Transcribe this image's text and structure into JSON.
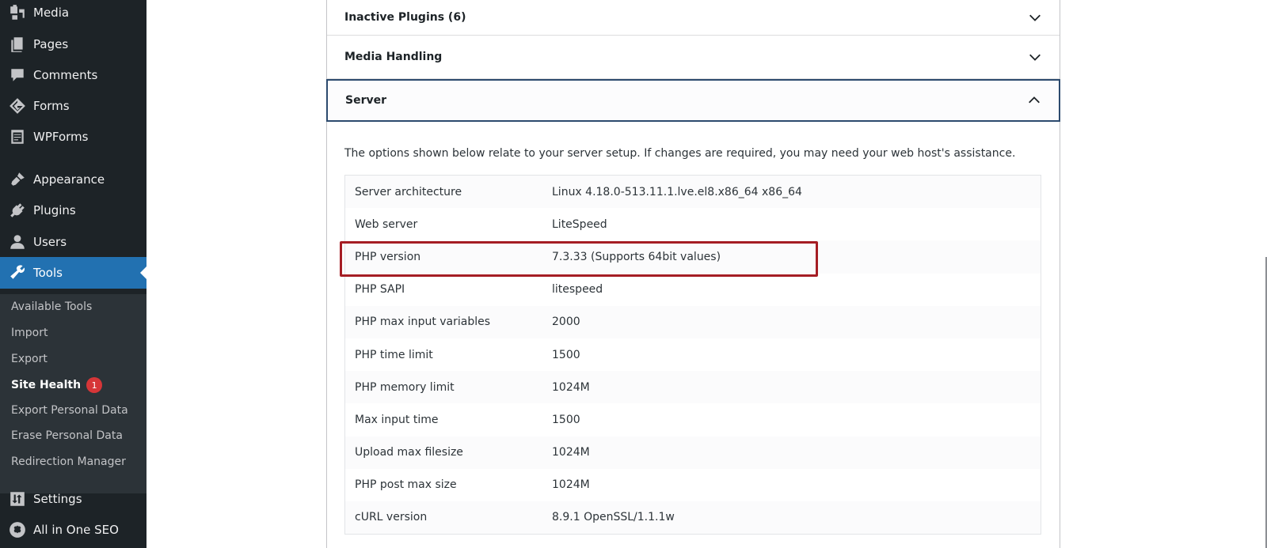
{
  "sidebar": {
    "menu": [
      {
        "label": "Media",
        "icon": "media-icon"
      },
      {
        "label": "Pages",
        "icon": "pages-icon"
      },
      {
        "label": "Comments",
        "icon": "comments-icon"
      },
      {
        "label": "Forms",
        "icon": "forms-icon"
      },
      {
        "label": "WPForms",
        "icon": "wpforms-icon"
      },
      {
        "label": "Appearance",
        "icon": "appearance-icon"
      },
      {
        "label": "Plugins",
        "icon": "plugins-icon"
      },
      {
        "label": "Users",
        "icon": "users-icon"
      },
      {
        "label": "Tools",
        "icon": "tools-icon",
        "active": true
      },
      {
        "label": "Settings",
        "icon": "settings-icon"
      },
      {
        "label": "All in One SEO",
        "icon": "aioseo-icon"
      }
    ],
    "submenu": [
      {
        "label": "Available Tools"
      },
      {
        "label": "Import"
      },
      {
        "label": "Export"
      },
      {
        "label": "Site Health",
        "current": true,
        "badge": "1"
      },
      {
        "label": "Export Personal Data"
      },
      {
        "label": "Erase Personal Data"
      },
      {
        "label": "Redirection Manager"
      }
    ]
  },
  "main": {
    "sections": [
      {
        "title": "Inactive Plugins (6)",
        "expanded": false
      },
      {
        "title": "Media Handling",
        "expanded": false
      },
      {
        "title": "Server",
        "expanded": true
      }
    ],
    "server_description": "The options shown below relate to your server setup. If changes are required, you may need your web host's assistance.",
    "server_info": [
      {
        "key": "Server architecture",
        "value": "Linux 4.18.0-513.11.1.lve.el8.x86_64 x86_64"
      },
      {
        "key": "Web server",
        "value": "LiteSpeed"
      },
      {
        "key": "PHP version",
        "value": "7.3.33 (Supports 64bit values)",
        "highlighted": true
      },
      {
        "key": "PHP SAPI",
        "value": "litespeed"
      },
      {
        "key": "PHP max input variables",
        "value": "2000"
      },
      {
        "key": "PHP time limit",
        "value": "1500"
      },
      {
        "key": "PHP memory limit",
        "value": "1024M"
      },
      {
        "key": "Max input time",
        "value": "1500"
      },
      {
        "key": "Upload max filesize",
        "value": "1024M"
      },
      {
        "key": "PHP post max size",
        "value": "1024M"
      },
      {
        "key": "cURL version",
        "value": "8.9.1 OpenSSL/1.1.1w"
      }
    ]
  },
  "colors": {
    "sidebar_bg": "#1d2327",
    "submenu_bg": "#2c3338",
    "active_bg": "#2271b1",
    "badge": "#d63638",
    "highlight_border": "#a51d24",
    "expanded_border": "#2c4a6e"
  }
}
